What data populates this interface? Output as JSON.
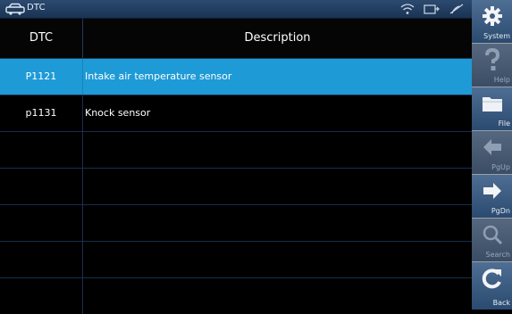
{
  "window": {
    "title": "DTC"
  },
  "table": {
    "columns": [
      "DTC",
      "Description"
    ],
    "rows": [
      {
        "code": "P1121",
        "description": "Intake air temperature sensor"
      },
      {
        "code": "p1131",
        "description": "Knock sensor"
      }
    ]
  },
  "sidebar": {
    "buttons": [
      {
        "label": "System",
        "icon": "gear-icon",
        "enabled": true
      },
      {
        "label": "Help",
        "icon": "question-icon",
        "enabled": false
      },
      {
        "label": "File",
        "icon": "folder-icon",
        "enabled": true
      },
      {
        "label": "PgUp",
        "icon": "arrow-left-icon",
        "enabled": false
      },
      {
        "label": "PgDn",
        "icon": "arrow-right-icon",
        "enabled": true
      },
      {
        "label": "Search",
        "icon": "search-icon",
        "enabled": false
      },
      {
        "label": "Back",
        "icon": "back-icon",
        "enabled": true
      }
    ]
  },
  "colors": {
    "selected_row": "#1e9ad6",
    "titlebar": "#2c4a70",
    "sidebar_button": "#3d5c82"
  }
}
